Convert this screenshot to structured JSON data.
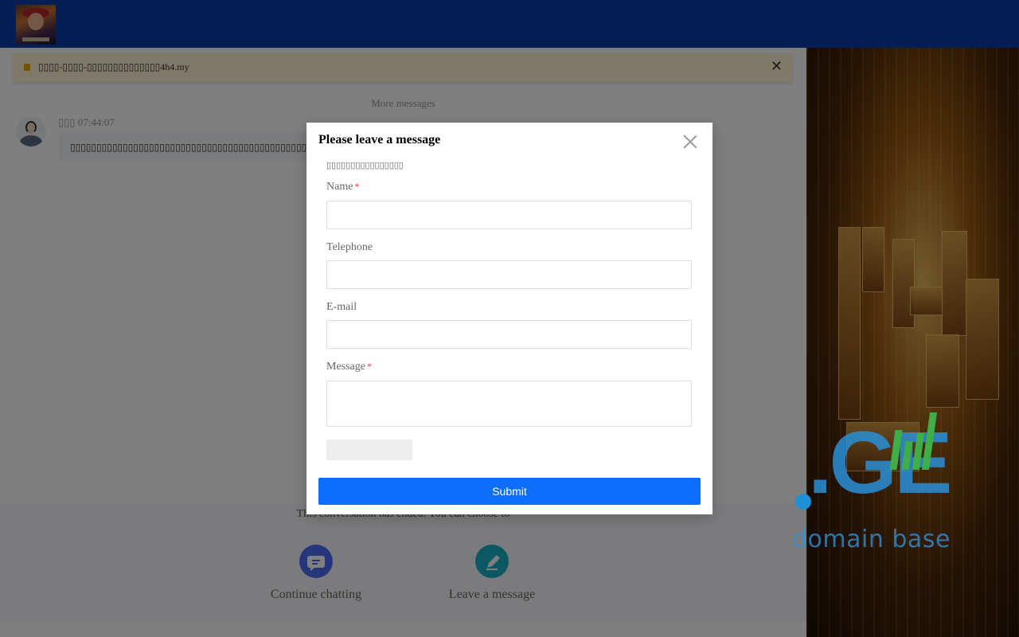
{
  "header": {
    "logo_icon": "game-logo-icon",
    "background_color": "#0b3ea8"
  },
  "notice": {
    "text": "▯▯▯▯-▯▯▯▯-▯▯▯▯▯▯▯▯▯▯▯▯▯▯4h4.my",
    "icon": "notice-bell-icon",
    "close_icon": "close-icon"
  },
  "chat": {
    "more_messages": "More messages",
    "agent_time": "▯▯▯ 07:44:07",
    "message_text": "▯▯▯▯▯▯▯▯▯▯▯▯▯▯▯▯▯▯▯▯▯▯▯▯▯▯▯▯▯▯▯▯▯▯▯▯▯▯▯▯▯▯▯▯▯▯▯▯~"
  },
  "footer": {
    "ended_text": "This conversation has ended. You can choose to",
    "actions": [
      {
        "label": "Continue chatting",
        "icon": "chat-bubble-icon",
        "color": "#4a6cf7"
      },
      {
        "label": "Leave a message",
        "icon": "pencil-icon",
        "color": "#16b0c4"
      }
    ]
  },
  "modal": {
    "title": "Please leave a message",
    "hint": "▯▯▯▯▯▯▯▯▯▯▯▯▯▯▯▯",
    "fields": [
      {
        "label": "Name",
        "required": true,
        "value": ""
      },
      {
        "label": "Telephone",
        "required": false,
        "value": ""
      },
      {
        "label": "E-mail",
        "required": false,
        "value": ""
      },
      {
        "label": "Message",
        "required": true,
        "value": ""
      }
    ],
    "required_mark": "*",
    "submit_label": "Submit",
    "submit_color": "#0d6efd"
  },
  "ad": {
    "watermark": ".GE",
    "tagline": "domain base"
  }
}
